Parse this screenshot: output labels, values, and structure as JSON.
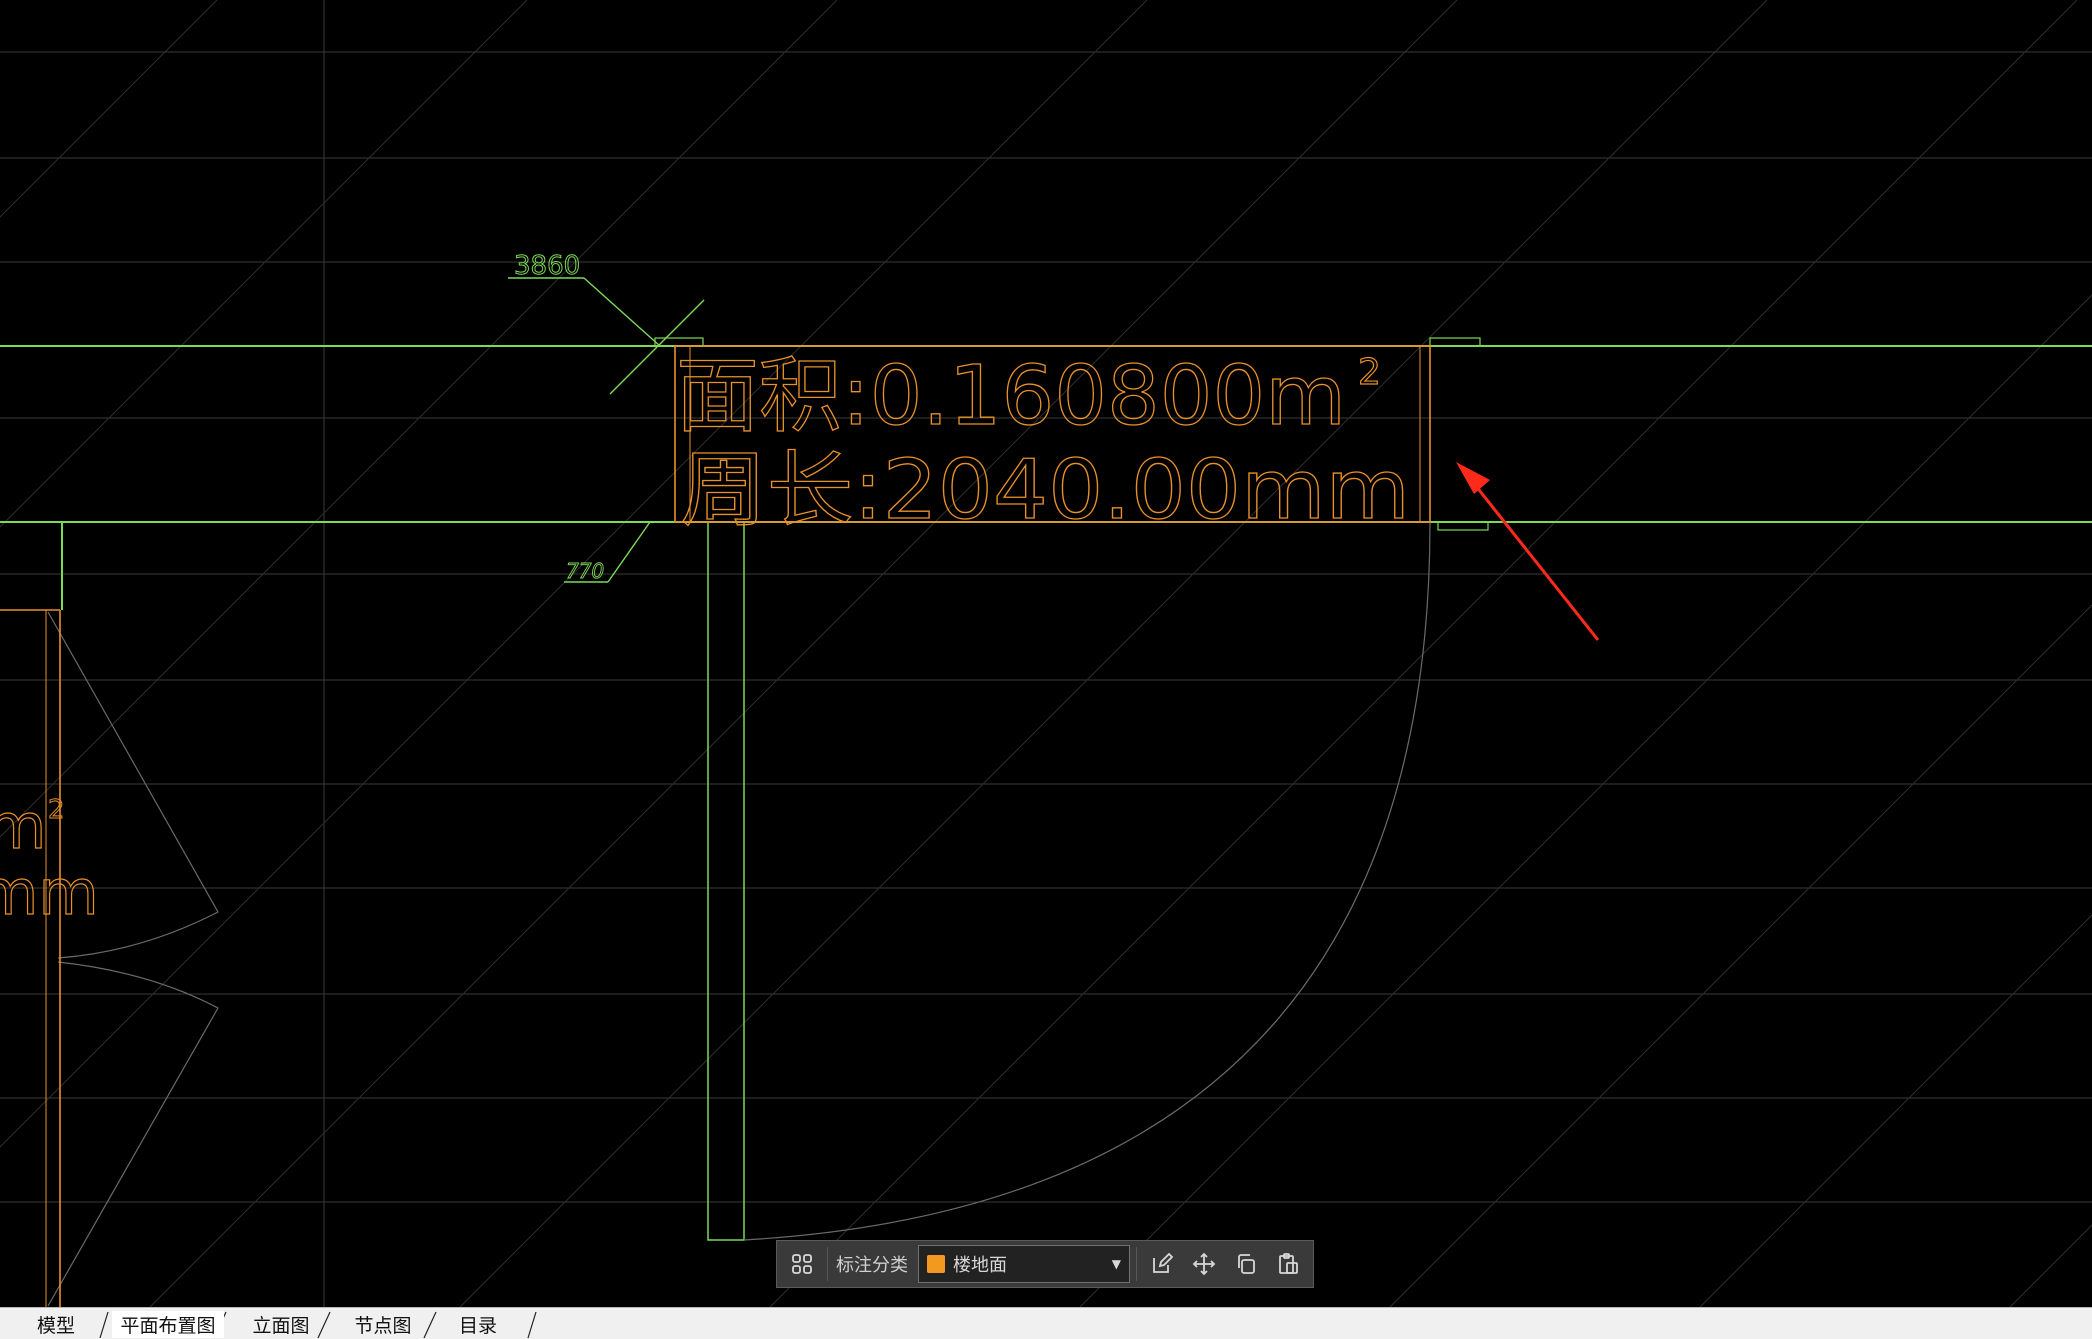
{
  "colors": {
    "background": "#000000",
    "grid": "#3a3a3a",
    "hatch": "#2e2e2e",
    "wall_green": "#7ed957",
    "annotation_orange": "#e8902a",
    "door_orange": "#e8902a",
    "arc_gray": "#6a6a6a",
    "arrow_red": "#ff2a1a"
  },
  "drawing": {
    "dimension_top": "3860",
    "dimension_bottom": "770",
    "area_label": "面积:0.160800m",
    "area_superscript": "2",
    "perimeter_label": "周长:2040.00mm",
    "left_partial_area": "m",
    "left_partial_area_superscript": "2",
    "left_partial_perimeter": "mm"
  },
  "toolbar": {
    "grid_icon": "grid-4-icon",
    "category_label": "标注分类",
    "category_value": "楼地面",
    "category_color": "#f29a1f",
    "edit_icon": "edit-icon",
    "move_icon": "move-icon",
    "copy_icon": "copy-icon",
    "paste_icon": "paste-icon"
  },
  "tabs": [
    {
      "label": "模型",
      "active": false
    },
    {
      "label": "平面布置图",
      "active": true
    },
    {
      "label": "立面图",
      "active": false
    },
    {
      "label": "节点图",
      "active": false
    },
    {
      "label": "目录",
      "active": false
    }
  ]
}
